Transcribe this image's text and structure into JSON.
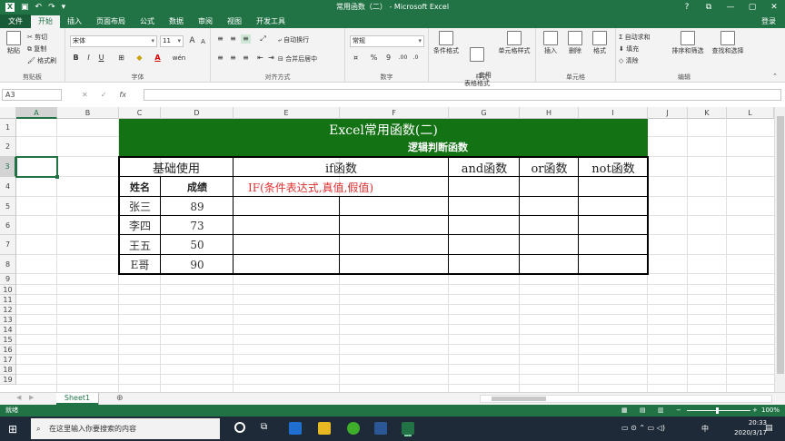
{
  "titlebar": {
    "title": "常用函数（二） - Microsoft Excel",
    "icons": [
      "save-icon",
      "undo-icon",
      "redo-icon",
      "customize-icon"
    ],
    "window_controls": [
      "?",
      "⧉",
      "—",
      "▢",
      "✕"
    ]
  },
  "tabs": {
    "items": [
      "文件",
      "开始",
      "插入",
      "页面布局",
      "公式",
      "数据",
      "审阅",
      "视图",
      "开发工具"
    ],
    "active": "开始",
    "login": "登录"
  },
  "ribbon": {
    "clipboard": {
      "label": "剪贴板",
      "paste": "粘贴",
      "cut": "剪切",
      "copy": "复制",
      "format_painter": "格式刷"
    },
    "font": {
      "label": "字体",
      "name": "宋体",
      "size": "11",
      "bold": "B",
      "italic": "I",
      "underline": "U",
      "wen": "wén",
      "size_up": "A",
      "size_down": "A"
    },
    "alignment": {
      "label": "对齐方式",
      "wrap": "自动换行",
      "merge": "合并后居中"
    },
    "number": {
      "label": "数字",
      "format": "常规",
      "percent": "%",
      "comma": "9"
    },
    "styles": {
      "label": "样式",
      "conditional": "条件格式",
      "table": "套用\n表格格式",
      "cell_styles": "单元格样式"
    },
    "cells": {
      "label": "单元格",
      "insert": "插入",
      "delete": "删除",
      "format": "格式"
    },
    "editing": {
      "label": "编辑",
      "autosum": "自动求和",
      "fill": "填充",
      "clear": "清除",
      "sort": "排序和筛选",
      "find": "查找和选择"
    }
  },
  "formula_bar": {
    "name_box": "A3",
    "cancel": "✕",
    "enter": "✓",
    "fx": "fx",
    "value": ""
  },
  "sheet": {
    "columns": [
      "A",
      "B",
      "C",
      "D",
      "E",
      "F",
      "G",
      "H",
      "I",
      "J",
      "K",
      "L"
    ],
    "selected_column": "A",
    "rows": [
      "1",
      "2",
      "3",
      "4",
      "5",
      "6",
      "7",
      "8",
      "9",
      "10",
      "11",
      "12",
      "13",
      "14",
      "15",
      "16",
      "17",
      "18",
      "19"
    ],
    "selected_row": "3",
    "title": "Excel常用函数(二)",
    "subtitle": "逻辑判断函数",
    "header_basic": "基础使用",
    "header_if": "if函数",
    "header_and": "and函数",
    "header_or": "or函数",
    "header_not": "not函数",
    "col_name": "姓名",
    "col_score": "成绩",
    "if_syntax": "IF(条件表达式,真值,假值)",
    "records": [
      {
        "name": "张三",
        "score": "89"
      },
      {
        "name": "李四",
        "score": "73"
      },
      {
        "name": "王五",
        "score": "50"
      },
      {
        "name": "E哥",
        "score": "90"
      }
    ],
    "title_bg": "#137213",
    "accent": "#217346",
    "syntax_color": "#e03030"
  },
  "sheet_tabs": {
    "active": "Sheet1",
    "add": "⊕"
  },
  "status": {
    "ready": "就绪",
    "zoom": "100%"
  },
  "taskbar": {
    "search_placeholder": "在这里输入你要搜索的内容",
    "ime": "中",
    "time": "20:33",
    "date": "2020/3/17"
  }
}
